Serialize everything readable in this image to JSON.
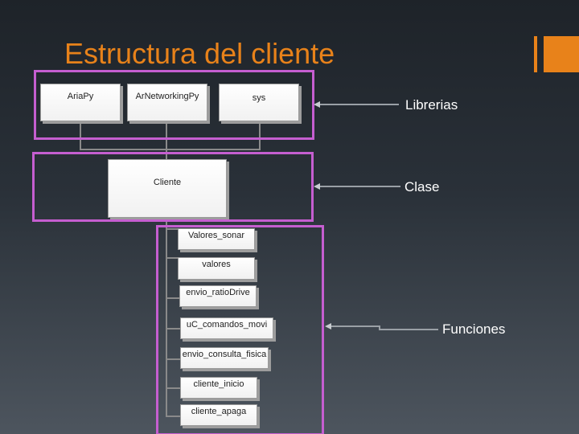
{
  "slide": {
    "title": "Estructura del cliente"
  },
  "diagram": {
    "libraries": [
      "AriaPy",
      "ArNetworkingPy",
      "sys"
    ],
    "class_name": "Cliente",
    "functions": [
      "Valores_sonar",
      "valores",
      "envio_ratioDrive",
      "uC_comandos_movi",
      "envio_consulta_fisica",
      "cliente_inicio",
      "cliente_apaga"
    ],
    "callouts": {
      "libraries": "Librerias",
      "class": "Clase",
      "functions": "Funciones"
    }
  },
  "colors": {
    "title": "#e8821a",
    "accent": "#e8821a",
    "group_frame": "#c55ed0",
    "callout_text": "#ffffff",
    "connector": "#8a8a8a"
  }
}
